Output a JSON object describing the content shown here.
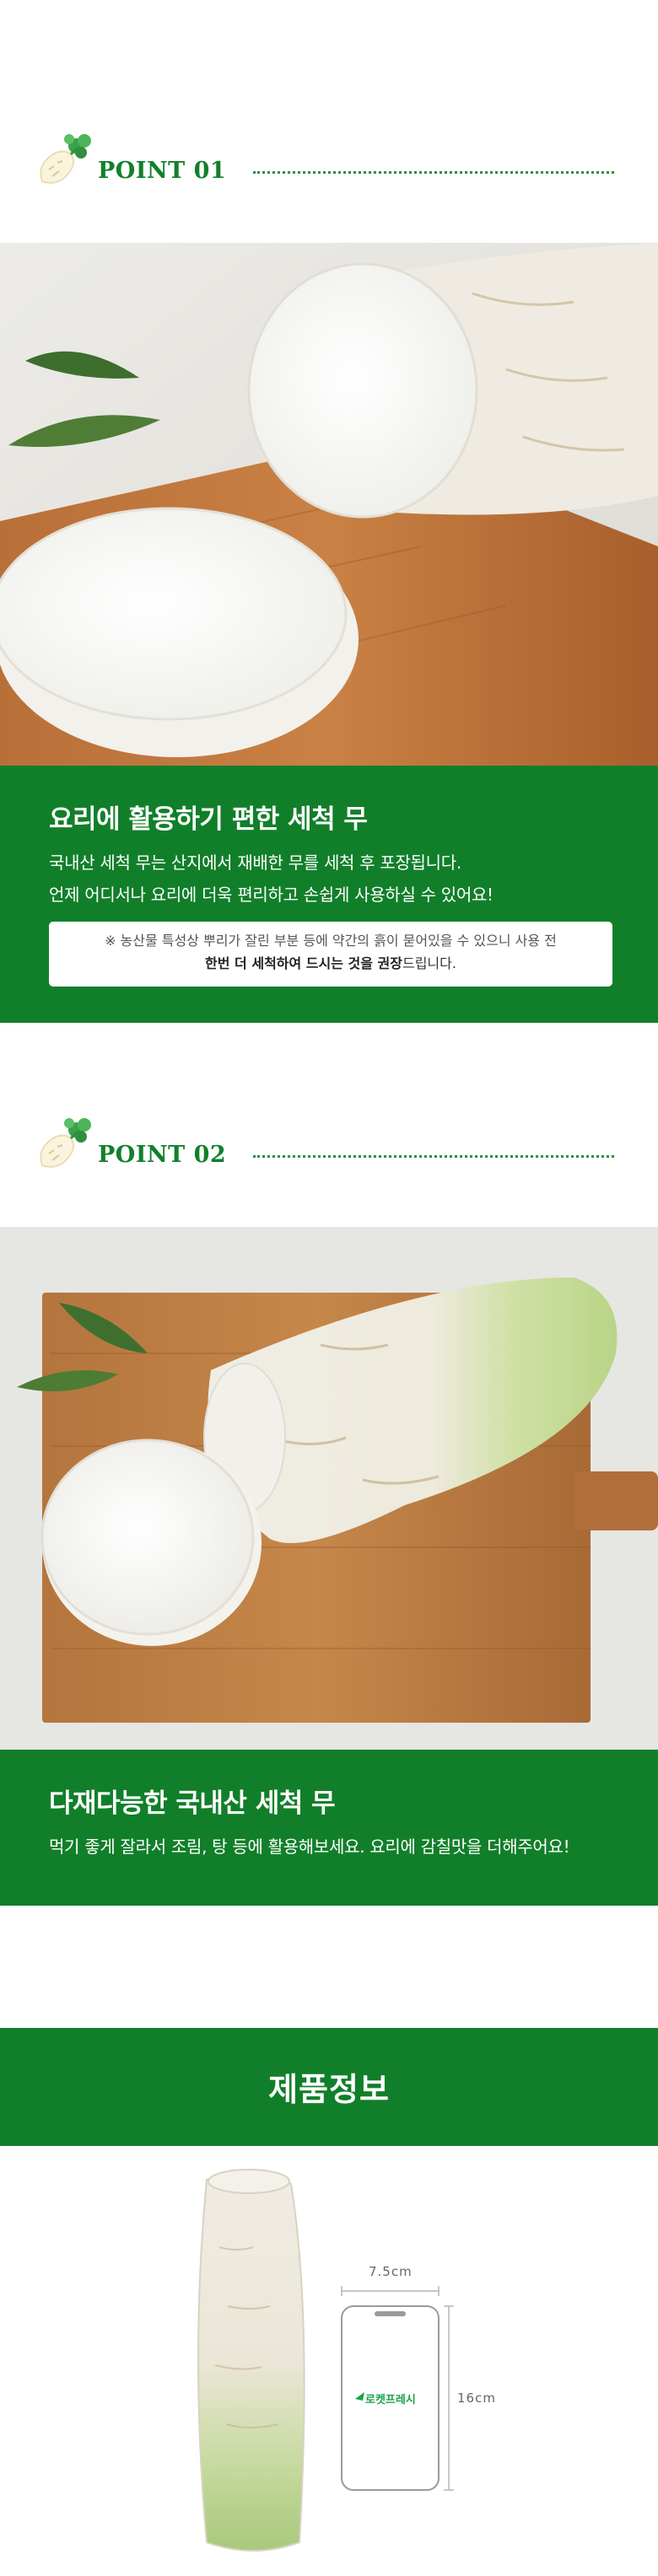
{
  "point1": {
    "title": "POINT 01",
    "heading": "요리에 활용하기 편한 세척 무",
    "line1": "국내산 세척 무는 산지에서 재배한 무를 세척 후 포장됩니다.",
    "line2": "언제 어디서나 요리에 더욱 편리하고 손쉽게 사용하실 수 있어요!",
    "note_line1": "※ 농산물 특성상 뿌리가 잘린 부분 등에 약간의 흙이 묻어있을 수 있으니 사용 전",
    "note_bold1": "한번 더 세척하여 드시는 것을 권장",
    "note_tail": "드립니다."
  },
  "point2": {
    "title": "POINT 02",
    "heading": "다재다능한 국내산 세척 무",
    "line1": "먹기 좋게 잘라서 조림, 탕 등에 활용해보세요. 요리에 감칠맛을 더해주어요!"
  },
  "product_info": {
    "title": "제품정보",
    "width_label": "7.5cm",
    "height_label": "16cm",
    "phone_logo": "로켓프레시"
  },
  "colors": {
    "brand_green": "#117f2a",
    "point_title": "#11802b"
  }
}
